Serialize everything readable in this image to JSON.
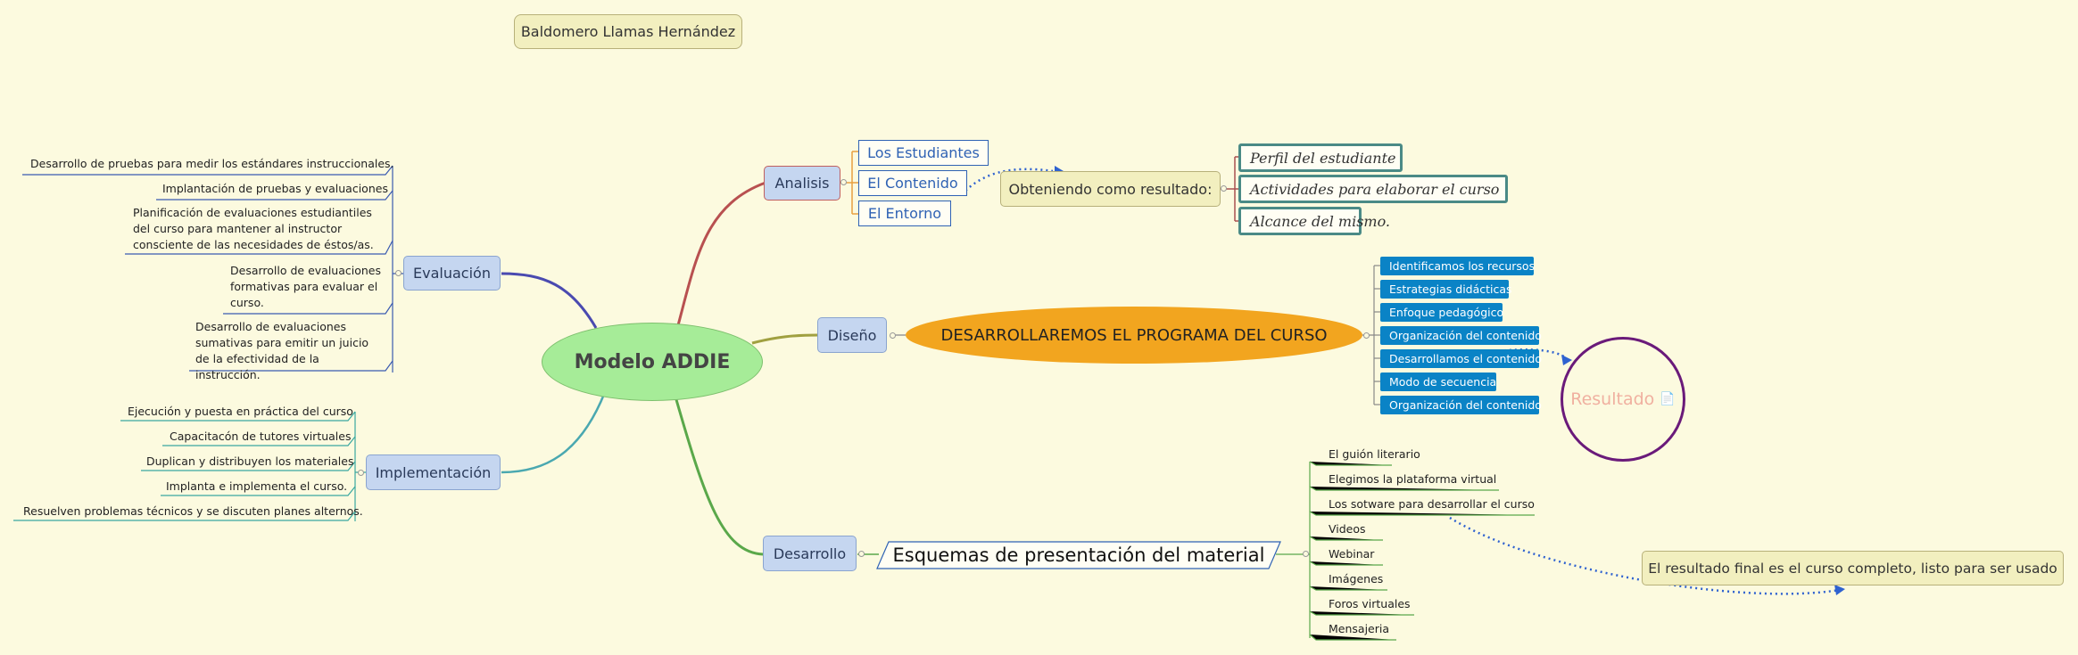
{
  "author": "Baldomero Llamas Hernández",
  "central": "Modelo ADDIE",
  "analisis": {
    "label": "Analisis",
    "items": [
      "Los Estudiantes",
      "El Contenido",
      "El Entorno"
    ],
    "result_label": "Obteniendo como resultado:",
    "results": [
      "Perfil del estudiante",
      "Actividades para elaborar el curso",
      "Alcance del mismo."
    ]
  },
  "diseno": {
    "label": "Diseño",
    "program": "DESARROLLAREMOS EL PROGRAMA DEL CURSO",
    "items": [
      "Identificamos los recursos",
      "Estrategias didácticas",
      "Enfoque pedagógico",
      "Organización del contenido",
      "Desarrollamos el contenido",
      "Modo de secuencia",
      "Organización del contenido"
    ],
    "result": "Resultado"
  },
  "desarrollo": {
    "label": "Desarrollo",
    "scheme": "Esquemas de presentación del material",
    "items": [
      "El guión literario",
      "Elegimos la plataforma virtual",
      "Los sotware para desarrollar el curso",
      "Videos",
      "Webinar",
      "Imágenes",
      "Foros virtuales",
      "Mensajeria"
    ],
    "final_result": "El resultado final es el curso completo, listo para ser usado"
  },
  "evaluacion": {
    "label": "Evaluación",
    "items": [
      "Desarrollo de pruebas para medir los estándares instruccionales.",
      "Implantación de pruebas y evaluaciones",
      "Planificación de evaluaciones estudiantiles del curso para mantener al instructor consciente de las necesidades de éstos/as.",
      "Desarrollo de evaluaciones formativas para evaluar el curso.",
      "Desarrollo de evaluaciones sumativas para emitir un juicio de la efectividad de la instrucción."
    ]
  },
  "implementacion": {
    "label": "Implementación",
    "items": [
      "Ejecución y puesta en práctica del curso",
      "Capacitacón de tutores virtuales",
      "Duplican y distribuyen los materiales",
      "Implanta e implementa el curso.",
      "Resuelven problemas técnicos y se discuten planes alternos."
    ]
  },
  "colors": {
    "background": "#fcfadf",
    "central_fill": "#a6ec98",
    "program_fill": "#f2a51f",
    "tag_blue": "#0a83c6",
    "result_circle": "#6a1a7a",
    "result_text": "#f0b0a0",
    "link_dotted": "#2f62d0"
  }
}
